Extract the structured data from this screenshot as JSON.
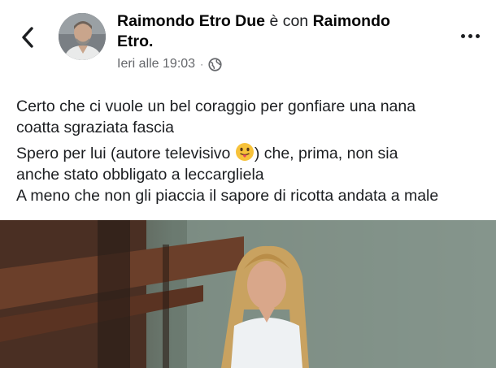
{
  "header": {
    "author": "Raimondo Etro Due",
    "with_word": "è con",
    "tagged": "Raimondo",
    "tagged_line2": "Etro.",
    "timestamp": "Ieri alle 19:03",
    "separator": "·",
    "privacy_icon": "globe-icon",
    "back_icon": "chevron-left-icon",
    "more_icon": "more-horizontal-icon"
  },
  "post": {
    "line1a": "Certo che ci vuole un bel coraggio per gonfiare una nana",
    "line1b": "coatta sgraziata fascia",
    "line2a": "Spero per lui (autore televisivo ",
    "line2a_after": ") che, prima, non sia",
    "line2b": "anche stato obbligato a leccargliela",
    "line3": "A meno che non gli piaccia il sapore di ricotta andata a male",
    "emoji": "tongue-out-emoji"
  },
  "colors": {
    "text": "#1c1e21",
    "secondary": "#65676b",
    "background": "#ffffff"
  }
}
